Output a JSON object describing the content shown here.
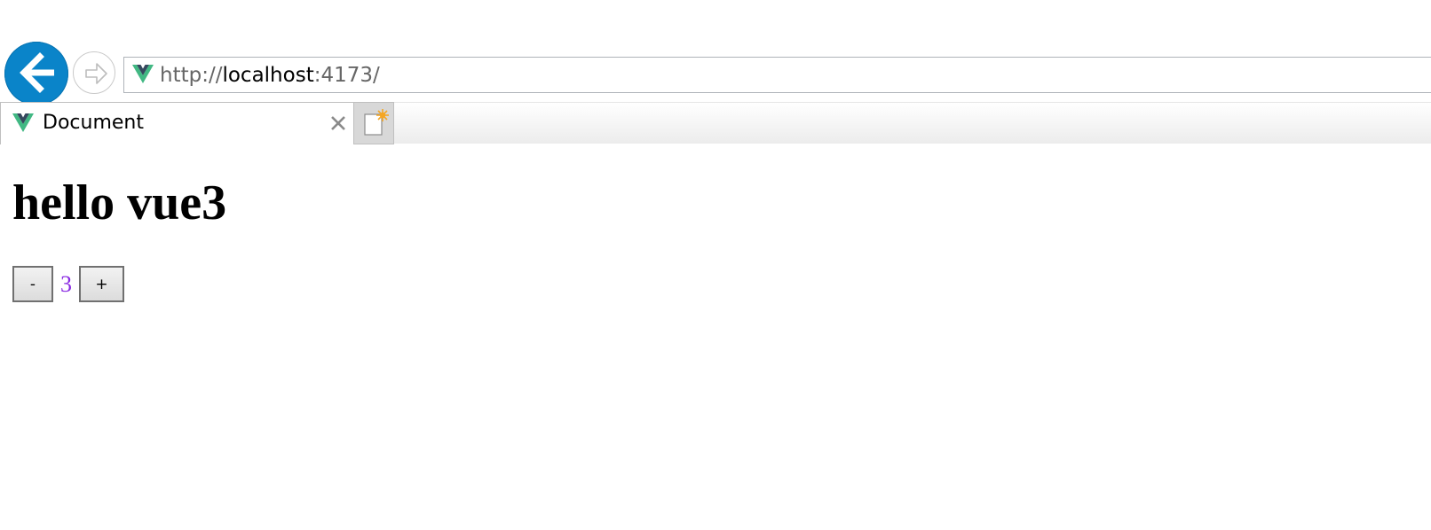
{
  "browser": {
    "address_bar": {
      "url_prefix": "http://",
      "url_host": "localhost",
      "url_suffix": ":4173/"
    },
    "tab": {
      "title": "Document",
      "close_glyph": "×",
      "favicon": "vue-logo-icon"
    },
    "buttons": {
      "back_icon": "back-arrow-icon",
      "forward_icon": "forward-arrow-icon",
      "new_tab_icon": "new-tab-icon"
    },
    "accent_color": "#0a84c9"
  },
  "page": {
    "heading": "hello vue3",
    "counter": {
      "decrement_label": "-",
      "value": "3",
      "increment_label": "+",
      "value_color": "#8a2be2"
    }
  }
}
